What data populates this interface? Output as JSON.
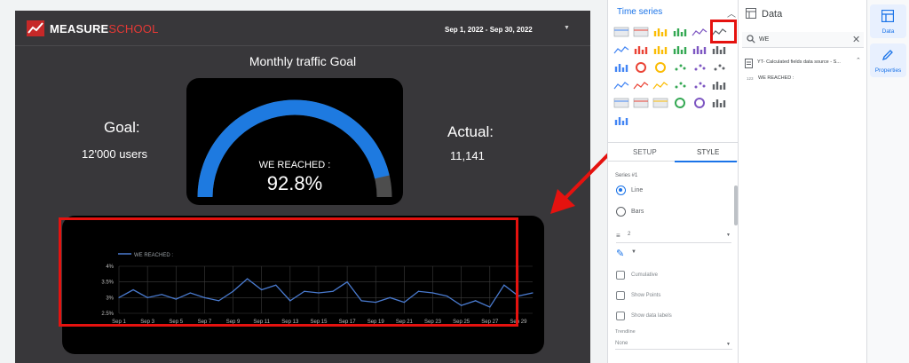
{
  "report": {
    "brand": {
      "part1": "MEASURE",
      "part2": "SCHOOL"
    },
    "date_range": "Sep 1, 2022 - Sep 30, 2022",
    "gauge_title": "Monthly traffic Goal",
    "goal": {
      "label": "Goal:",
      "value": "12'000 users"
    },
    "actual": {
      "label": "Actual:",
      "value": "11,141"
    },
    "gauge": {
      "label": "WE REACHED :",
      "display": "92.8%",
      "fraction": 0.928,
      "fill_color": "#1e7ae0",
      "track_color": "#4d4d4d"
    }
  },
  "chart_data": {
    "type": "line",
    "legend": "WE REACHED :",
    "x": [
      "Sep 1",
      "Sep 2",
      "Sep 3",
      "Sep 4",
      "Sep 5",
      "Sep 6",
      "Sep 7",
      "Sep 8",
      "Sep 9",
      "Sep 10",
      "Sep 11",
      "Sep 12",
      "Sep 13",
      "Sep 14",
      "Sep 15",
      "Sep 16",
      "Sep 17",
      "Sep 18",
      "Sep 19",
      "Sep 20",
      "Sep 21",
      "Sep 22",
      "Sep 23",
      "Sep 24",
      "Sep 25",
      "Sep 26",
      "Sep 27",
      "Sep 28",
      "Sep 29",
      "Sep 30"
    ],
    "x_tick_labels": [
      "Sep 1",
      "Sep 3",
      "Sep 5",
      "Sep 7",
      "Sep 9",
      "Sep 11",
      "Sep 13",
      "Sep 15",
      "Sep 17",
      "Sep 19",
      "Sep 21",
      "Sep 23",
      "Sep 25",
      "Sep 27",
      "Sep 29"
    ],
    "series": [
      {
        "name": "WE REACHED :",
        "values": [
          3.0,
          3.25,
          3.0,
          3.1,
          2.95,
          3.15,
          3.0,
          2.9,
          3.2,
          3.6,
          3.25,
          3.4,
          2.9,
          3.2,
          3.15,
          3.2,
          3.5,
          2.9,
          2.85,
          3.0,
          2.85,
          3.2,
          3.15,
          3.05,
          2.75,
          2.9,
          2.7,
          3.4,
          3.05,
          3.15
        ]
      }
    ],
    "y_ticks": [
      "4%",
      "3.5%",
      "3%",
      "2.5%"
    ],
    "ylim": [
      2.5,
      4.0
    ],
    "line_color": "#4a7bd0",
    "grid": true
  },
  "picker": {
    "title": "Time series",
    "tabs": [
      "SETUP",
      "STYLE"
    ],
    "series_label": "Series #1",
    "options": [
      "Line",
      "Bars"
    ],
    "line_weight": "2",
    "checkboxes": [
      "Cumulative",
      "Show Points",
      "Show data labels"
    ],
    "trendline_label": "Trendline",
    "trendline_value": "None"
  },
  "data_panel": {
    "title": "Data",
    "search_value": "WE",
    "datasource": "YT- Calculated fields data source - S...",
    "field_type": "123",
    "field_name": "WE REACHED :"
  },
  "rail": {
    "items": [
      "Data",
      "Properties"
    ]
  },
  "colors": {
    "annotation": "#e5120f",
    "accent": "#1a73e8"
  }
}
